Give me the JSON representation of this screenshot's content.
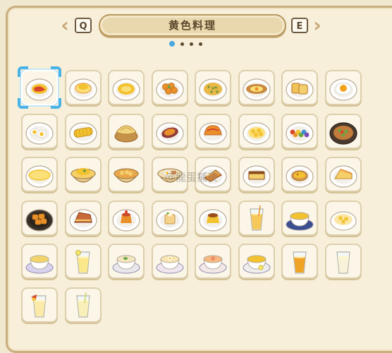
{
  "header": {
    "title": "黄色料理",
    "prev_key": "Q",
    "next_key": "E",
    "left_arrow": "‹",
    "right_arrow": "›"
  },
  "pagination": {
    "pages": 4,
    "current": 1
  },
  "watermark": "@龍蛋捕夜",
  "dishes": [
    {
      "icon": "omelette-rice-icon",
      "kind": "plate-ketchup",
      "selected": true
    },
    {
      "icon": "pancake-icon",
      "kind": "plate-pancake"
    },
    {
      "icon": "soup-plate-icon",
      "kind": "plate-soup"
    },
    {
      "icon": "fried-dumpling-icon",
      "kind": "plate-balls"
    },
    {
      "icon": "paella-icon",
      "kind": "plate-paella"
    },
    {
      "icon": "egg-boat-bread-icon",
      "kind": "plate-boat"
    },
    {
      "icon": "toast-icon",
      "kind": "plate-toast"
    },
    {
      "icon": "fried-egg-icon",
      "kind": "plate-egg"
    },
    {
      "icon": "boiled-eggs-icon",
      "kind": "plate-halfeggs"
    },
    {
      "icon": "corn-icon",
      "kind": "plate-corn"
    },
    {
      "icon": "steamed-bun-icon",
      "kind": "steamer"
    },
    {
      "icon": "sweet-potato-icon",
      "kind": "plate-potato"
    },
    {
      "icon": "omelette-icon",
      "kind": "plate-omelette"
    },
    {
      "icon": "scrambled-eggs-icon",
      "kind": "plate-scrambled"
    },
    {
      "icon": "rainbow-rice-icon",
      "kind": "plate-rainbow"
    },
    {
      "icon": "noodle-bowl-icon",
      "kind": "bowl-dark"
    },
    {
      "icon": "omelette-plate-icon",
      "kind": "plate-flatomelette"
    },
    {
      "icon": "rice-bowl-icon",
      "kind": "bowl-rice"
    },
    {
      "icon": "curry-bowl-icon",
      "kind": "bowl-curry"
    },
    {
      "icon": "ramen-bowl-icon",
      "kind": "bowl-ramen"
    },
    {
      "icon": "lasagna-icon",
      "kind": "plate-lasagna"
    },
    {
      "icon": "castella-icon",
      "kind": "plate-castella"
    },
    {
      "icon": "egg-tart-icon",
      "kind": "plate-tart"
    },
    {
      "icon": "cheesecake-icon",
      "kind": "plate-cake"
    },
    {
      "icon": "fried-chunks-icon",
      "kind": "plate-dark-chunks"
    },
    {
      "icon": "pie-slice-icon",
      "kind": "plate-pie"
    },
    {
      "icon": "pudding-icon",
      "kind": "plate-pudding"
    },
    {
      "icon": "parfait-icon",
      "kind": "plate-parfait"
    },
    {
      "icon": "custard-pudding-icon",
      "kind": "plate-flan"
    },
    {
      "icon": "juice-glass-icon",
      "kind": "glass-juice"
    },
    {
      "icon": "tea-cup-icon",
      "kind": "cup-blue"
    },
    {
      "icon": "dessert-bowl-icon",
      "kind": "bowl-dessert"
    },
    {
      "icon": "soup-cup-icon",
      "kind": "cup-soup"
    },
    {
      "icon": "lemonade-icon",
      "kind": "glass-lemonade"
    },
    {
      "icon": "herb-soup-icon",
      "kind": "cup-herb"
    },
    {
      "icon": "egg-soup-icon",
      "kind": "cup-egg"
    },
    {
      "icon": "peach-soup-icon",
      "kind": "cup-peach"
    },
    {
      "icon": "lemon-tea-icon",
      "kind": "cup-lemon"
    },
    {
      "icon": "orange-juice-icon",
      "kind": "glass-orange"
    },
    {
      "icon": "milk-glass-icon",
      "kind": "glass-milk"
    },
    {
      "icon": "fruit-drink-icon",
      "kind": "glass-fruit"
    },
    {
      "icon": "lemon-soda-icon",
      "kind": "glass-soda"
    }
  ]
}
